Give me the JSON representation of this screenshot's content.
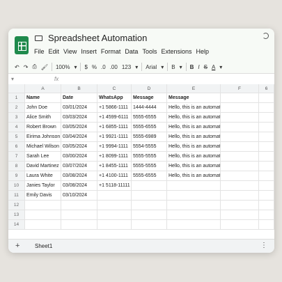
{
  "app": {
    "title": "Spreadsheet Automation"
  },
  "menu": [
    "File",
    "Edit",
    "View",
    "Insert",
    "Format",
    "Data",
    "Tools",
    "Extensions",
    "Help"
  ],
  "toolbar": {
    "undo": "↶",
    "redo": "↷",
    "print": "⎙",
    "paint": "🖌",
    "zoom": "100%",
    "currency": "$",
    "percent": "%",
    "dec_decrease": ".0",
    "dec_increase": ".00",
    "num_format": "123",
    "font": "Arial",
    "font_size": "B",
    "bold": "B",
    "italic": "I",
    "strike": "S",
    "text_color": "A"
  },
  "formula_bar": {
    "fx": "fx"
  },
  "columns": [
    "A",
    "B",
    "C",
    "D",
    "E",
    "F",
    "6"
  ],
  "headers": [
    "Name",
    "Date",
    "WhatsApp",
    "Message",
    "Message"
  ],
  "rows": [
    [
      "John Doe",
      "03/01/2024",
      "+1 5866-1111",
      "1444-4444",
      "Hello, this is an automated message."
    ],
    [
      "Alice Smith",
      "03/03/2024",
      "+1 4599-6111",
      "5555-6555",
      "Hello, this is an automated message."
    ],
    [
      "Robert Brown",
      "03/05/2024",
      "+1 6855-1111",
      "5555-6555",
      "Hello, this is an automated message."
    ],
    [
      "Eirima Johnson",
      "03/04/2024",
      "+1 9921-1111",
      "5555-6989",
      "Hello, this is an automated message."
    ],
    [
      "Michael Wilson",
      "03/05/2024",
      "+1 9994-1111",
      "5554-5555",
      "Hello, this is an automated message."
    ],
    [
      "Sarah Lee",
      "03/00/2024",
      "+1 8099-1111",
      "5555-5555",
      "Hello, this is an automated message."
    ],
    [
      "David Martinez",
      "03/07/2024",
      "+1 8455-1111",
      "5555-5555",
      "Hello, this is an automated message."
    ],
    [
      "Laura White",
      "03/08/2024",
      "+1 4100-1111",
      "5555-6555",
      "Hello, this is an automated message."
    ],
    [
      "Janies Taylor",
      "03/08/2024",
      "+1 5118-11111",
      "",
      ""
    ],
    [
      "Emily Davis",
      "03/10/2024",
      "",
      "",
      ""
    ],
    [
      "",
      "",
      "",
      "",
      ""
    ],
    [
      "",
      "",
      "",
      "",
      ""
    ],
    [
      "",
      "",
      "",
      "",
      ""
    ]
  ],
  "sheetbar": {
    "add": "+",
    "tab": "Sheet1",
    "more": "⋮"
  }
}
